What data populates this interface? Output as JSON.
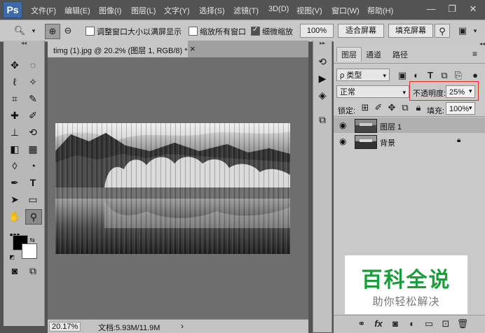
{
  "app": {
    "logo": "Ps"
  },
  "menu": [
    "文件(F)",
    "编辑(E)",
    "图像(I)",
    "图层(L)",
    "文字(Y)",
    "选择(S)",
    "滤镜(T)",
    "3D(D)",
    "视图(V)",
    "窗口(W)",
    "帮助(H)"
  ],
  "window_controls": {
    "minimize": "—",
    "restore": "❐",
    "close": "✕"
  },
  "options": {
    "resize_windows": "调整窗口大小以满屏显示",
    "zoom_all_windows": "缩放所有窗口",
    "scrubby_zoom": "细微缩放",
    "scrubby_checked": true,
    "zoom_percent": "100%",
    "fit_screen": "适合屏幕",
    "fill_screen": "填充屏幕"
  },
  "document": {
    "tab_title": "timg (1).jpg @ 20.2% (图层 1, RGB/8) *",
    "close_symbol": "×",
    "zoom": "20.17%",
    "doc_size": "文档:5.93M/11.9M",
    "status_arrow": "›"
  },
  "layers_panel": {
    "tabs": [
      "图层",
      "通道",
      "路径"
    ],
    "filter_kind": "ρ 类型",
    "blend_mode": "正常",
    "opacity_label": "不透明度:",
    "opacity_value": "25%",
    "lock_label": "锁定:",
    "fill_label": "填充:",
    "fill_value": "100%",
    "layers": [
      {
        "name": "图层 1",
        "selected": true
      },
      {
        "name": "背景",
        "locked": true
      }
    ]
  },
  "watermark": {
    "title": "百科全说",
    "subtitle": "助你轻松解决"
  },
  "colors": {
    "highlight_box": "#e03030",
    "watermark_green": "#1a9e3a"
  }
}
